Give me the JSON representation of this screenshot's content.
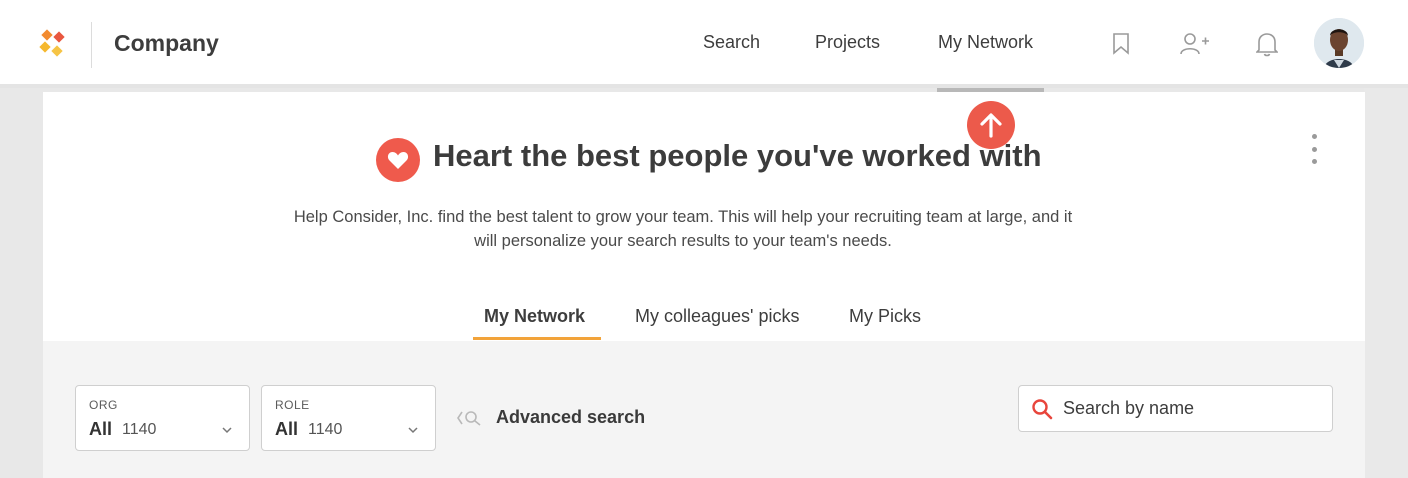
{
  "header": {
    "brand": "Company",
    "nav": [
      {
        "label": "Search"
      },
      {
        "label": "Projects"
      },
      {
        "label": "My Network"
      }
    ],
    "icons": [
      "bookmark-icon",
      "add-user-icon",
      "bell-icon"
    ],
    "active_nav": "My Network"
  },
  "hero": {
    "headline": "Heart the best people you've worked with",
    "description": "Help Consider, Inc. find the best talent to grow your team. This will help your recruiting team at large, and it will personalize your search results to your team's needs.",
    "tabs": [
      {
        "label": "My Network",
        "active": true
      },
      {
        "label": "My colleagues' picks",
        "active": false
      },
      {
        "label": "My Picks",
        "active": false
      }
    ]
  },
  "filters": {
    "org": {
      "label": "ORG",
      "value": "All",
      "count": "1140"
    },
    "role": {
      "label": "ROLE",
      "value": "All",
      "count": "1140"
    },
    "advanced_search_label": "Advanced search",
    "search_placeholder": "Search by name"
  },
  "colors": {
    "accent_red": "#ef5a4c",
    "tab_underline": "#f2a33a"
  }
}
